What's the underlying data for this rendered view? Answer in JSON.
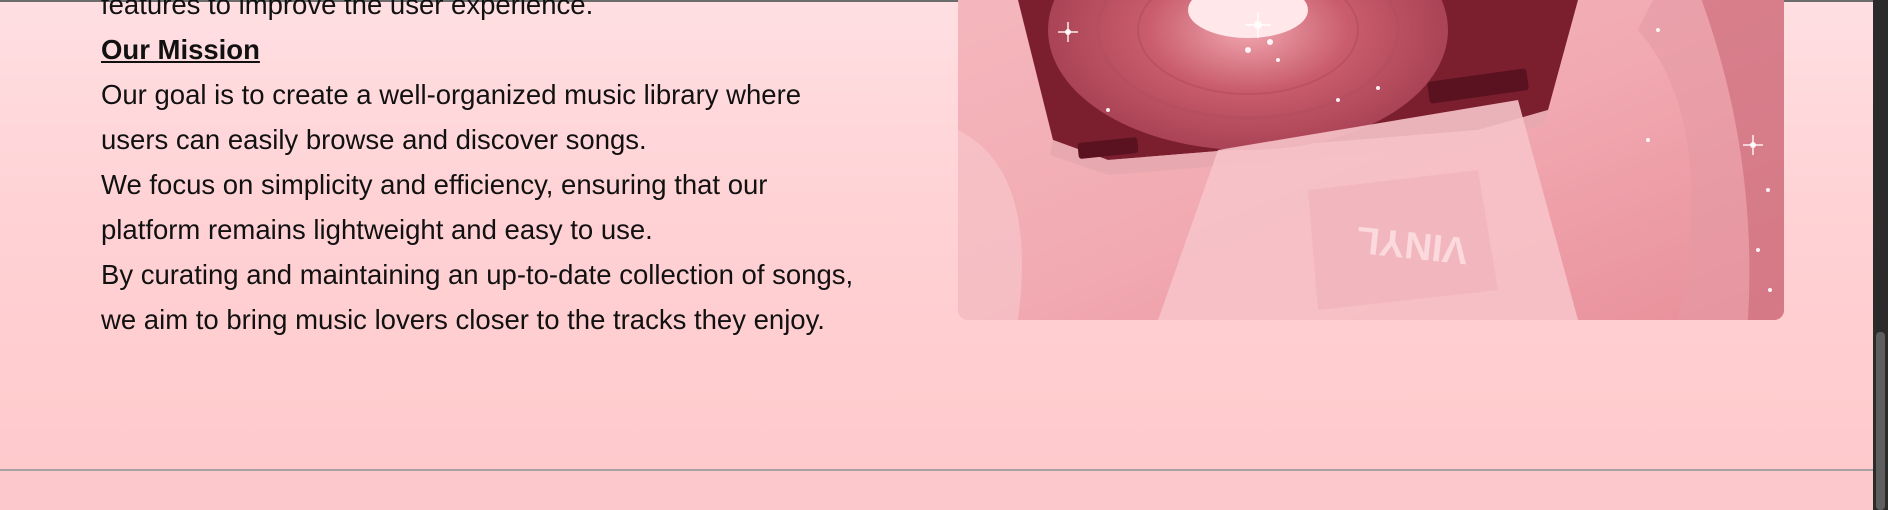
{
  "about": {
    "previous_line": "features to improve the user experience.",
    "mission_heading": "Our Mission",
    "mission_lines": [
      "Our goal is to create a well-organized music library where",
      "users can easily browse and discover songs.",
      "We focus on simplicity and efficiency, ensuring that our",
      "platform remains lightweight and easy to use.",
      "By curating and maintaining an up-to-date collection of songs,",
      "we aim to bring music lovers closer to the tracks they enjoy."
    ]
  },
  "image": {
    "alt": "Pink record player",
    "tint": "#e47b86",
    "record_label": "VINYL"
  },
  "colors": {
    "page_top": "#ffdfe2",
    "page_bottom": "#ffc8cb",
    "footer": "#fcc8cb"
  }
}
